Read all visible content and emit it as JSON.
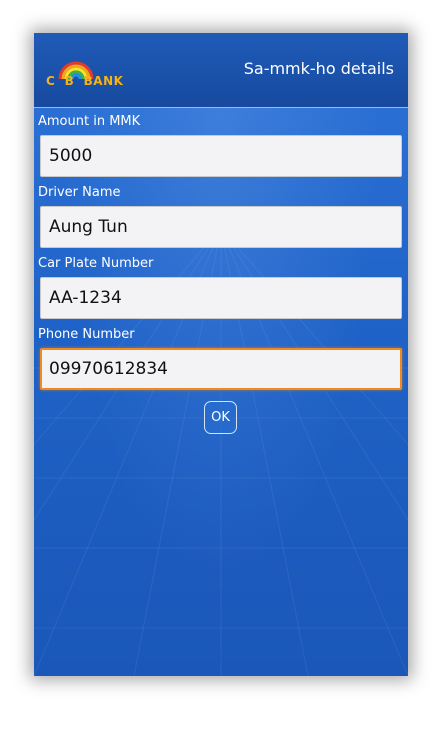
{
  "header": {
    "logo_text": "C  B  BANK",
    "title": "Sa-mmk-ho details"
  },
  "form": {
    "amount": {
      "label": "Amount in MMK",
      "value": "5000"
    },
    "driver": {
      "label": "Driver Name",
      "value": "Aung Tun"
    },
    "plate": {
      "label": "Car Plate Number",
      "value": "AA-1234"
    },
    "phone": {
      "label": "Phone Number",
      "value": "09970612834"
    }
  },
  "actions": {
    "ok_label": "OK"
  },
  "colors": {
    "header_bg": "#174a9f",
    "screen_bg": "#1f62c7",
    "logo_text": "#f4b21b",
    "focus_border": "#f08a1c"
  }
}
